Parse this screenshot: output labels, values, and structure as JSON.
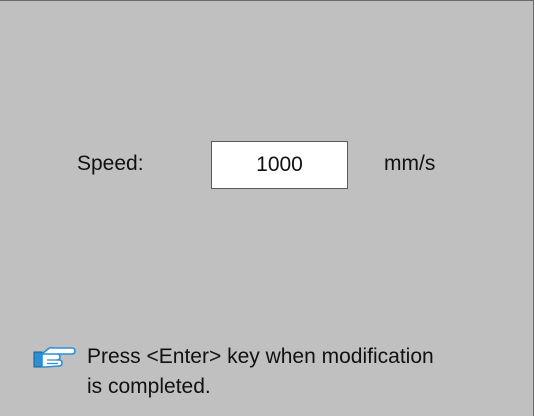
{
  "form": {
    "speed_label": "Speed:",
    "speed_value": "1000",
    "unit": "mm/s"
  },
  "hint": {
    "icon": "pointing-hand-icon",
    "line1": "Press <Enter> key when modification",
    "line2": "is completed."
  },
  "colors": {
    "background": "#c0c0c0",
    "field": "#ffffff",
    "icon_accent": "#2b8fd6"
  }
}
